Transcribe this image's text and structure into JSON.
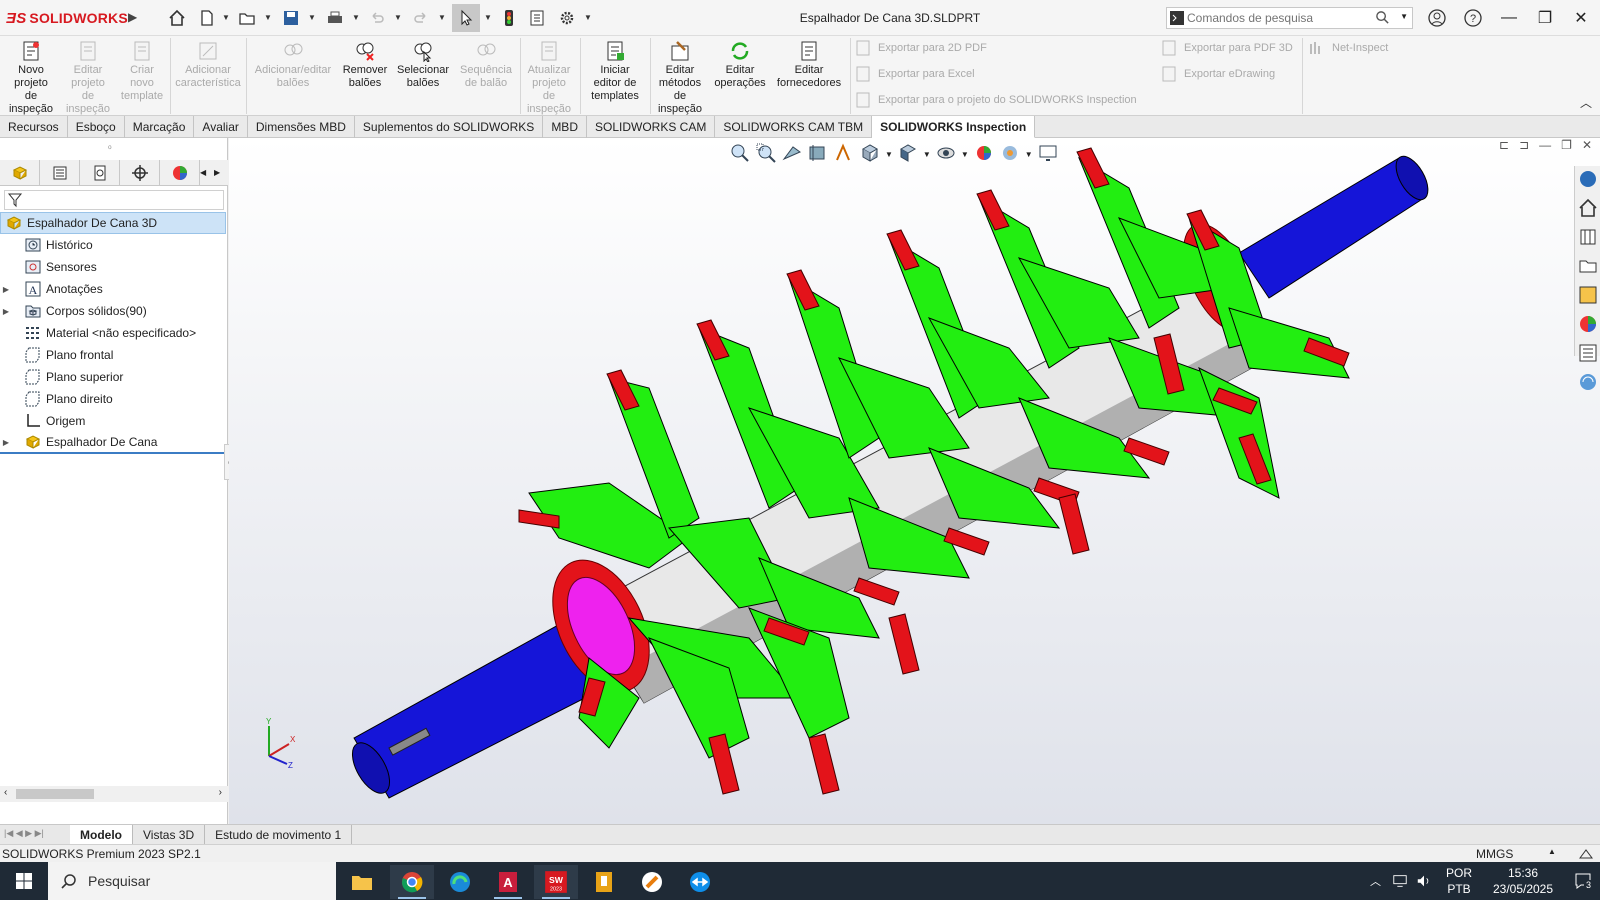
{
  "app": {
    "brand": "SOLIDWORKS",
    "document_title": "Espalhador De Cana 3D.SLDPRT",
    "search": {
      "placeholder": "Comandos de pesquisa"
    }
  },
  "ribbon": {
    "buttons": [
      {
        "label": "Novo\nprojeto\nde\ninspeção",
        "enabled": true,
        "icon": "new-inspection-project-icon"
      },
      {
        "label": "Editar\nprojeto\nde\ninspeção",
        "enabled": false,
        "icon": "edit-inspection-project-icon"
      },
      {
        "label": "Criar\nnovo\ntemplate",
        "enabled": false,
        "icon": "new-template-icon"
      },
      {
        "label": "Adicionar\ncaracterística",
        "enabled": false,
        "icon": "add-characteristic-icon"
      },
      {
        "label": "Adicionar/editar\nbalões",
        "enabled": false,
        "icon": "add-balloons-icon"
      },
      {
        "label": "Remover\nbalões",
        "enabled": true,
        "icon": "remove-balloons-icon"
      },
      {
        "label": "Selecionar\nbalões",
        "enabled": true,
        "icon": "select-balloons-icon"
      },
      {
        "label": "Sequência\nde balão",
        "enabled": false,
        "icon": "balloon-sequence-icon"
      },
      {
        "label": "Atualizar\nprojeto\nde\ninspeção",
        "enabled": false,
        "icon": "update-inspection-icon"
      },
      {
        "label": "Iniciar\neditor de\ntemplates",
        "enabled": true,
        "icon": "template-editor-icon"
      },
      {
        "label": "Editar\nmétodos\nde\ninspeção",
        "enabled": true,
        "icon": "inspection-methods-icon"
      },
      {
        "label": "Editar\noperações",
        "enabled": true,
        "icon": "operations-icon"
      },
      {
        "label": "Editar\nfornecedores",
        "enabled": true,
        "icon": "vendors-icon"
      }
    ],
    "exports_left": [
      "Exportar para 2D PDF",
      "Exportar para Excel",
      "Exportar para o projeto do SOLIDWORKS Inspection"
    ],
    "exports_right": [
      "Exportar para PDF 3D",
      "Exportar eDrawing"
    ],
    "net_inspect": "Net-Inspect"
  },
  "tabs": [
    {
      "label": "Recursos",
      "active": false
    },
    {
      "label": "Esboço",
      "active": false
    },
    {
      "label": "Marcação",
      "active": false
    },
    {
      "label": "Avaliar",
      "active": false
    },
    {
      "label": "Dimensões MBD",
      "active": false
    },
    {
      "label": "Suplementos do SOLIDWORKS",
      "active": false
    },
    {
      "label": "MBD",
      "active": false
    },
    {
      "label": "SOLIDWORKS CAM",
      "active": false
    },
    {
      "label": "SOLIDWORKS CAM TBM",
      "active": false
    },
    {
      "label": "SOLIDWORKS Inspection",
      "active": true
    }
  ],
  "feature_tree": {
    "root": "Espalhador De Cana 3D",
    "items": [
      {
        "label": "Histórico",
        "icon": "history-icon",
        "expandable": false
      },
      {
        "label": "Sensores",
        "icon": "sensors-icon",
        "expandable": false
      },
      {
        "label": "Anotações",
        "icon": "annotations-icon",
        "expandable": true
      },
      {
        "label": "Corpos sólidos(90)",
        "icon": "solid-bodies-icon",
        "expandable": true
      },
      {
        "label": "Material <não especificado>",
        "icon": "material-icon",
        "expandable": false
      },
      {
        "label": "Plano frontal",
        "icon": "plane-icon",
        "expandable": false
      },
      {
        "label": "Plano superior",
        "icon": "plane-icon",
        "expandable": false
      },
      {
        "label": "Plano direito",
        "icon": "plane-icon",
        "expandable": false
      },
      {
        "label": "Origem",
        "icon": "origin-icon",
        "expandable": false
      },
      {
        "label": "Espalhador De Cana",
        "icon": "part-feature-icon",
        "expandable": true
      }
    ]
  },
  "triad": {
    "x": "X",
    "y": "Y",
    "z": "Z"
  },
  "bottom_tabs": [
    {
      "label": "Modelo",
      "active": true
    },
    {
      "label": "Vistas 3D",
      "active": false
    },
    {
      "label": "Estudo de movimento 1",
      "active": false
    }
  ],
  "status": {
    "product": "SOLIDWORKS Premium 2023 SP2.1",
    "units": "MMGS"
  },
  "taskbar": {
    "search": "Pesquisar",
    "lang1": "POR",
    "lang2": "PTB",
    "time": "15:36",
    "date": "23/05/2025",
    "notifications": "3"
  },
  "colors": {
    "accent_red": "#d71920",
    "body_green": "#22ee11",
    "tip_red": "#e3131a",
    "shaft_blue": "#1515d8",
    "hub_magenta": "#ee22ee"
  }
}
